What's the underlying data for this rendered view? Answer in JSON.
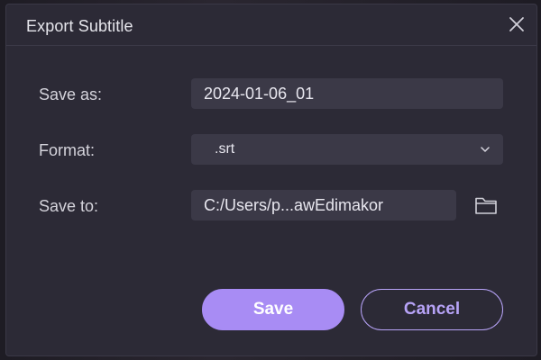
{
  "dialog": {
    "title": "Export Subtitle",
    "close_icon": "close-icon"
  },
  "form": {
    "save_as_label": "Save as:",
    "save_as_value": "2024-01-06_01",
    "format_label": "Format:",
    "format_value": ".srt",
    "save_to_label": "Save to:",
    "save_to_value": "C:/Users/p...awEdimakor",
    "folder_icon": "folder-icon",
    "dropdown_icon": "chevron-down-icon"
  },
  "buttons": {
    "save_label": "Save",
    "cancel_label": "Cancel"
  },
  "colors": {
    "dialog_bg": "#2c2a36",
    "field_bg": "#3b3947",
    "accent": "#a88cf4",
    "cancel_text": "#b7a3f7"
  }
}
